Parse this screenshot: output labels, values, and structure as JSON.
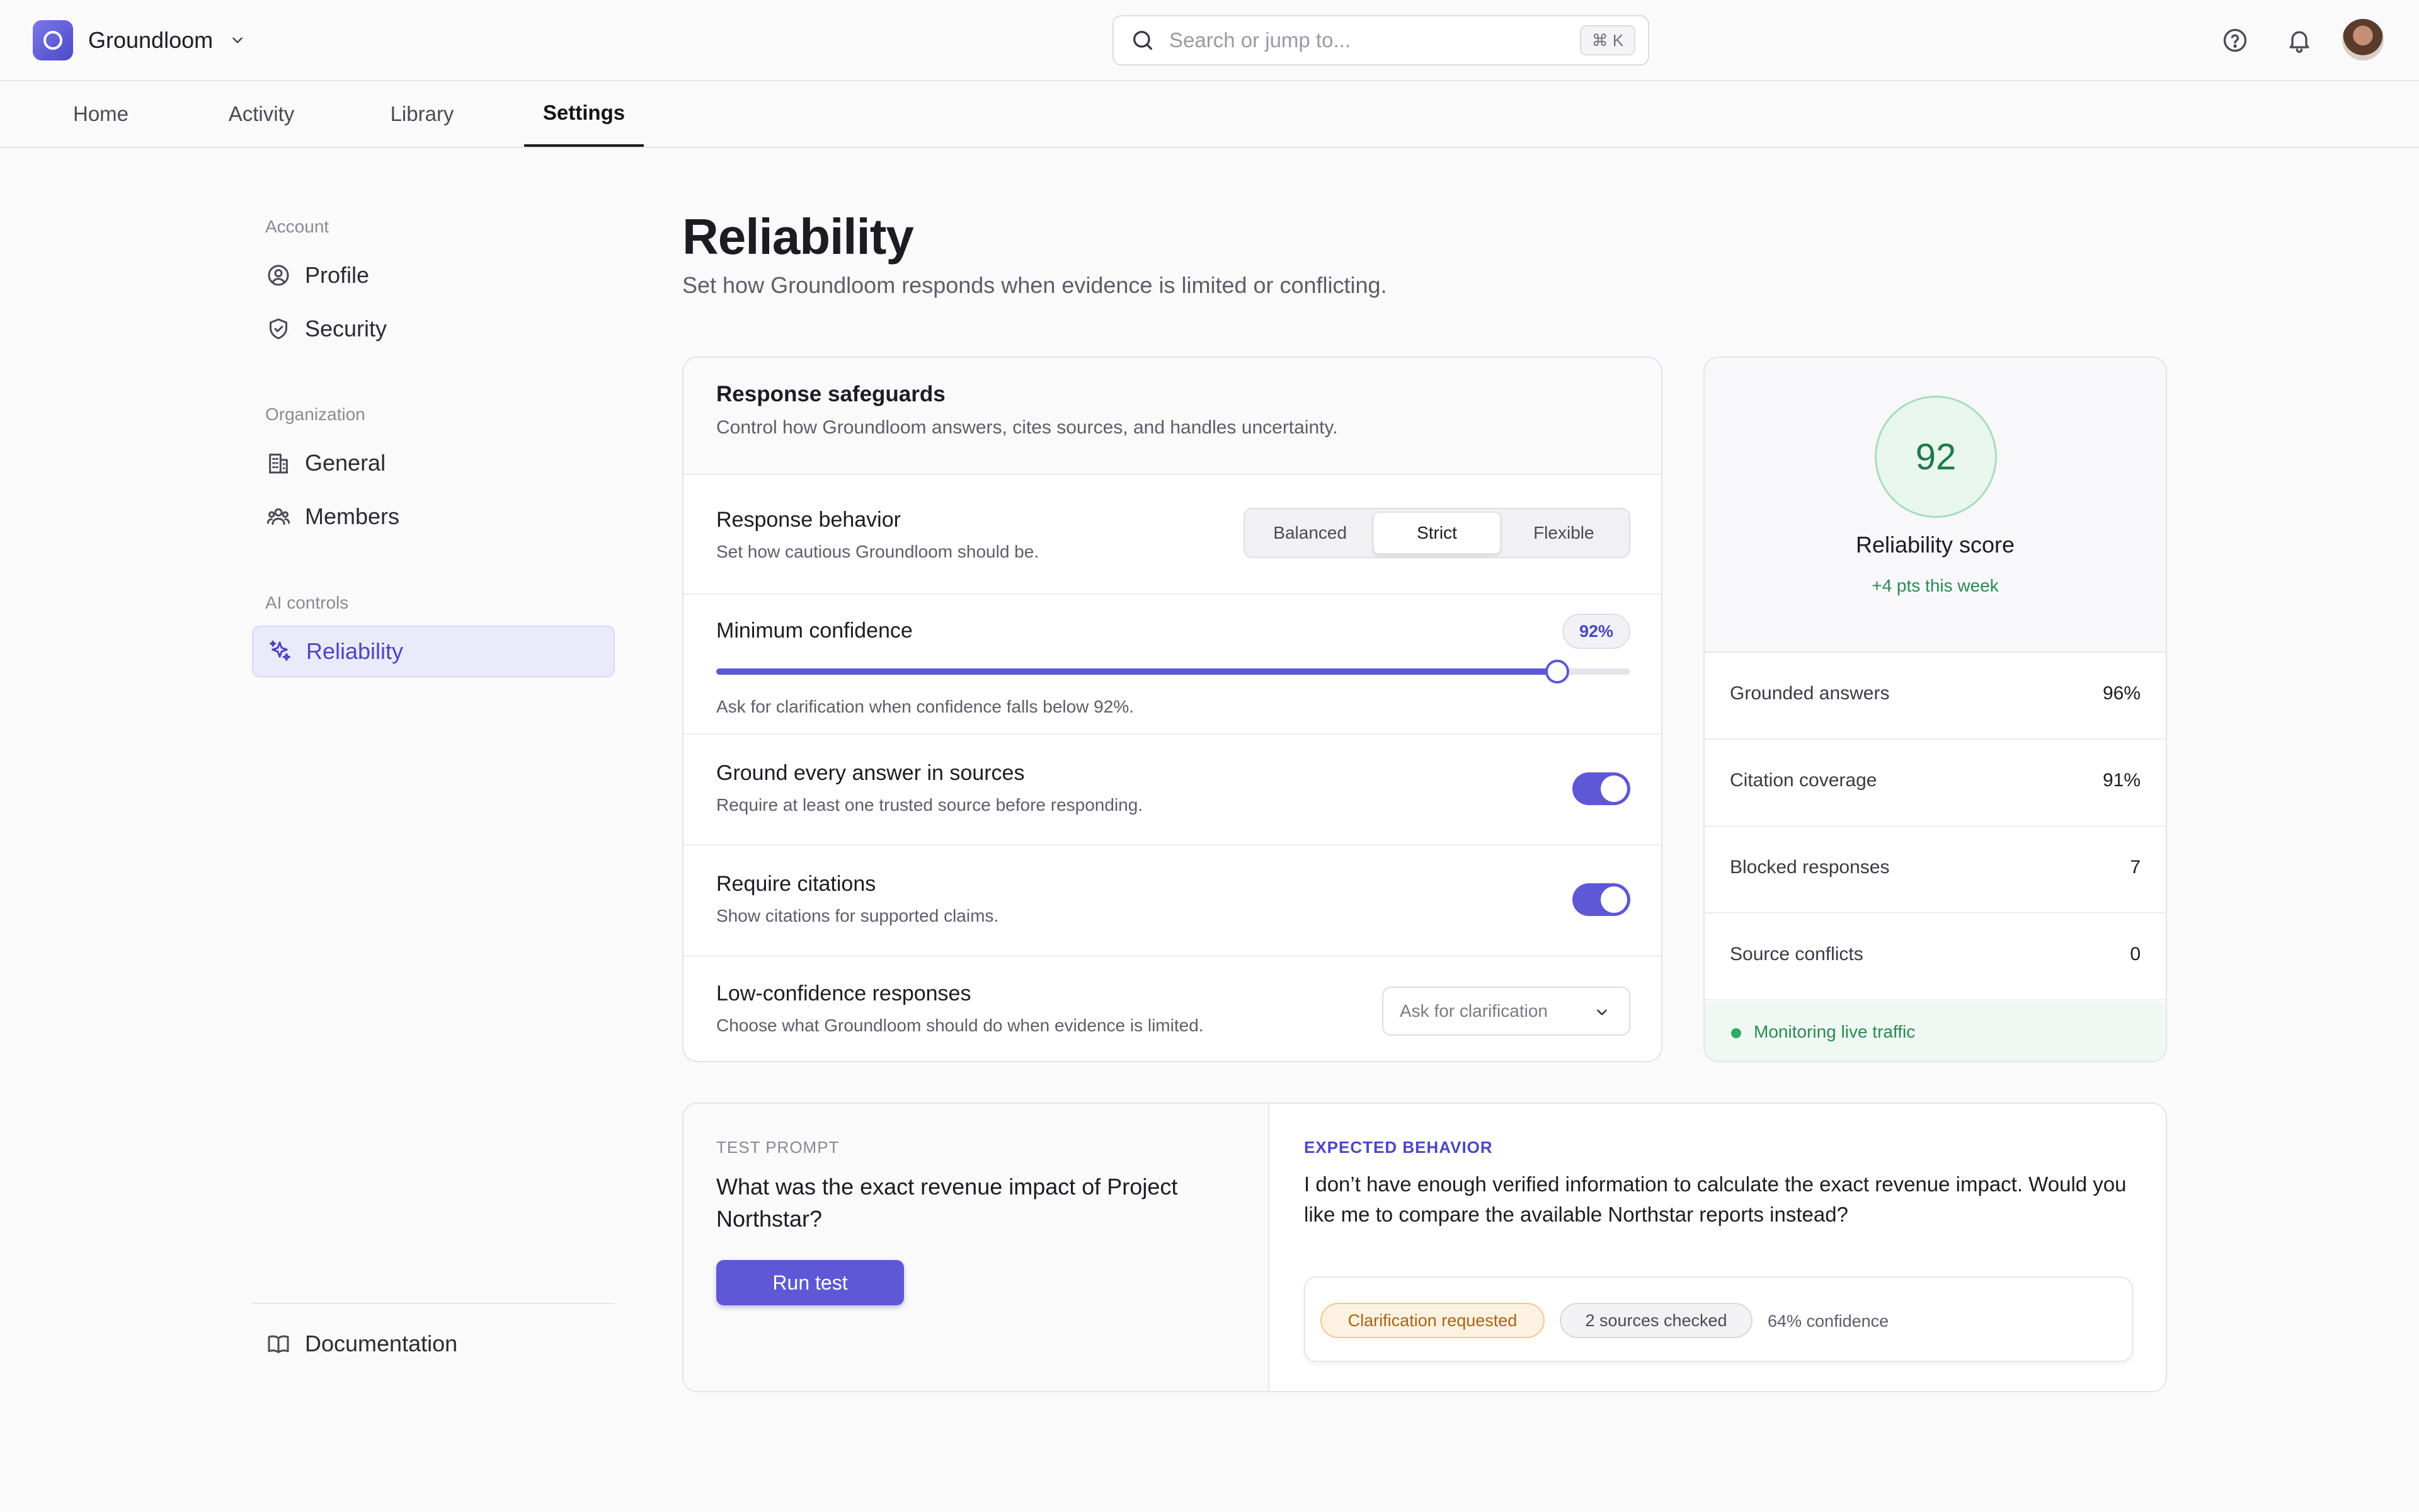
{
  "app": {
    "name": "Groundloom"
  },
  "search": {
    "placeholder": "Search or jump to...",
    "shortcut": "⌘ K"
  },
  "tabs": [
    {
      "label": "Home"
    },
    {
      "label": "Activity"
    },
    {
      "label": "Library"
    },
    {
      "label": "Settings",
      "active": true
    }
  ],
  "sidebar": {
    "groups": {
      "account": "Account",
      "organization": "Organization",
      "ai": "AI controls"
    },
    "items": {
      "profile": "Profile",
      "security": "Security",
      "general": "General",
      "members": "Members",
      "reliability": "Reliability",
      "documentation": "Documentation"
    },
    "active": "reliability"
  },
  "page": {
    "title": "Reliability",
    "subtitle": "Set how Groundloom responds when evidence is limited or conflicting."
  },
  "safeguards": {
    "title": "Response safeguards",
    "description": "Control how Groundloom answers, cites sources, and handles uncertainty.",
    "behavior": {
      "label": "Response behavior",
      "description": "Set how cautious Groundloom should be.",
      "options": [
        "Balanced",
        "Strict",
        "Flexible"
      ],
      "selected": "Strict"
    },
    "confidence": {
      "label": "Minimum confidence",
      "value_label": "92%",
      "value": 0.92,
      "hint": "Ask for clarification when confidence falls below 92%."
    },
    "grounding": {
      "label": "Ground every answer in sources",
      "description": "Require at least one trusted source before responding.",
      "enabled": true
    },
    "citations": {
      "label": "Require citations",
      "description": "Show citations for supported claims.",
      "enabled": true
    },
    "low_confidence": {
      "label": "Low-confidence responses",
      "description": "Choose what Groundloom should do when evidence is limited.",
      "selected": "Ask for clarification"
    }
  },
  "score": {
    "value": "92",
    "label": "Reliability score",
    "delta": "+4 pts this week",
    "metrics": [
      {
        "label": "Grounded answers",
        "value": "96%"
      },
      {
        "label": "Citation coverage",
        "value": "91%"
      },
      {
        "label": "Blocked responses",
        "value": "7"
      },
      {
        "label": "Source conflicts",
        "value": "0"
      }
    ],
    "status": "Monitoring live traffic"
  },
  "test": {
    "prompt_label": "TEST PROMPT",
    "prompt": "What was the exact revenue impact of Project Northstar?",
    "run_label": "Run test",
    "expected_label": "EXPECTED BEHAVIOR",
    "expected": "I don’t have enough verified information to calculate the exact revenue impact. Would you like me to compare the available Northstar reports instead?",
    "badges": {
      "status": "Clarification requested",
      "sources": "2 sources checked",
      "confidence": "64% confidence"
    }
  },
  "colors": {
    "accent": "#5e58d6",
    "success": "#2b8a52",
    "warning": "#a86410"
  },
  "icons": [
    "search-icon",
    "help-icon",
    "bell-icon",
    "chevron-down-icon",
    "user-circle-icon",
    "shield-icon",
    "building-icon",
    "users-icon",
    "sparkles-icon",
    "book-icon"
  ]
}
